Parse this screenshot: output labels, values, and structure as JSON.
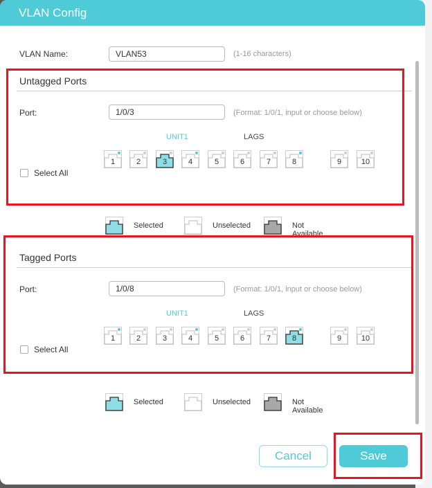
{
  "dialog": {
    "title": "VLAN Config"
  },
  "vlan_name": {
    "label": "VLAN Name:",
    "value": "VLAN53",
    "hint": "(1-16 characters)"
  },
  "colors": {
    "accent": "#4ecbd6",
    "selected_fill": "#8fdde6",
    "not_available_fill": "#a8a8a8",
    "highlight": "#e8141e",
    "link_dot": "#4ecbd6",
    "idle_dot": "#cccccc"
  },
  "untagged": {
    "title": "Untagged Ports",
    "port_label": "Port:",
    "port_value": "1/0/3",
    "hint": "(Format: 1/0/1, input or choose below)",
    "unit_label": "UNIT1",
    "lags_label": "LAGS",
    "select_all": "Select All",
    "ports": [
      {
        "num": "1",
        "state": "unselected",
        "link": true
      },
      {
        "num": "2",
        "state": "unselected",
        "link": false
      },
      {
        "num": "3",
        "state": "selected",
        "link": false
      },
      {
        "num": "4",
        "state": "unselected",
        "link": true
      },
      {
        "num": "5",
        "state": "unselected",
        "link": false
      },
      {
        "num": "6",
        "state": "unselected",
        "link": false
      },
      {
        "num": "7",
        "state": "unselected",
        "link": false
      },
      {
        "num": "8",
        "state": "unselected",
        "link": true
      },
      {
        "num": "9",
        "state": "unselected",
        "link": false
      },
      {
        "num": "10",
        "state": "unselected",
        "link": false
      }
    ]
  },
  "tagged": {
    "title": "Tagged Ports",
    "port_label": "Port:",
    "port_value": "1/0/8",
    "hint": "(Format: 1/0/1, input or choose below)",
    "unit_label": "UNIT1",
    "lags_label": "LAGS",
    "select_all": "Select All",
    "ports": [
      {
        "num": "1",
        "state": "unselected",
        "link": true
      },
      {
        "num": "2",
        "state": "unselected",
        "link": false
      },
      {
        "num": "3",
        "state": "unselected",
        "link": false
      },
      {
        "num": "4",
        "state": "unselected",
        "link": true
      },
      {
        "num": "5",
        "state": "unselected",
        "link": false
      },
      {
        "num": "6",
        "state": "unselected",
        "link": false
      },
      {
        "num": "7",
        "state": "unselected",
        "link": false
      },
      {
        "num": "8",
        "state": "selected",
        "link": true
      },
      {
        "num": "9",
        "state": "unselected",
        "link": false
      },
      {
        "num": "10",
        "state": "unselected",
        "link": false
      }
    ]
  },
  "legend": {
    "selected": "Selected",
    "unselected": "Unselected",
    "not_available": "Not Available"
  },
  "buttons": {
    "cancel": "Cancel",
    "save": "Save"
  }
}
